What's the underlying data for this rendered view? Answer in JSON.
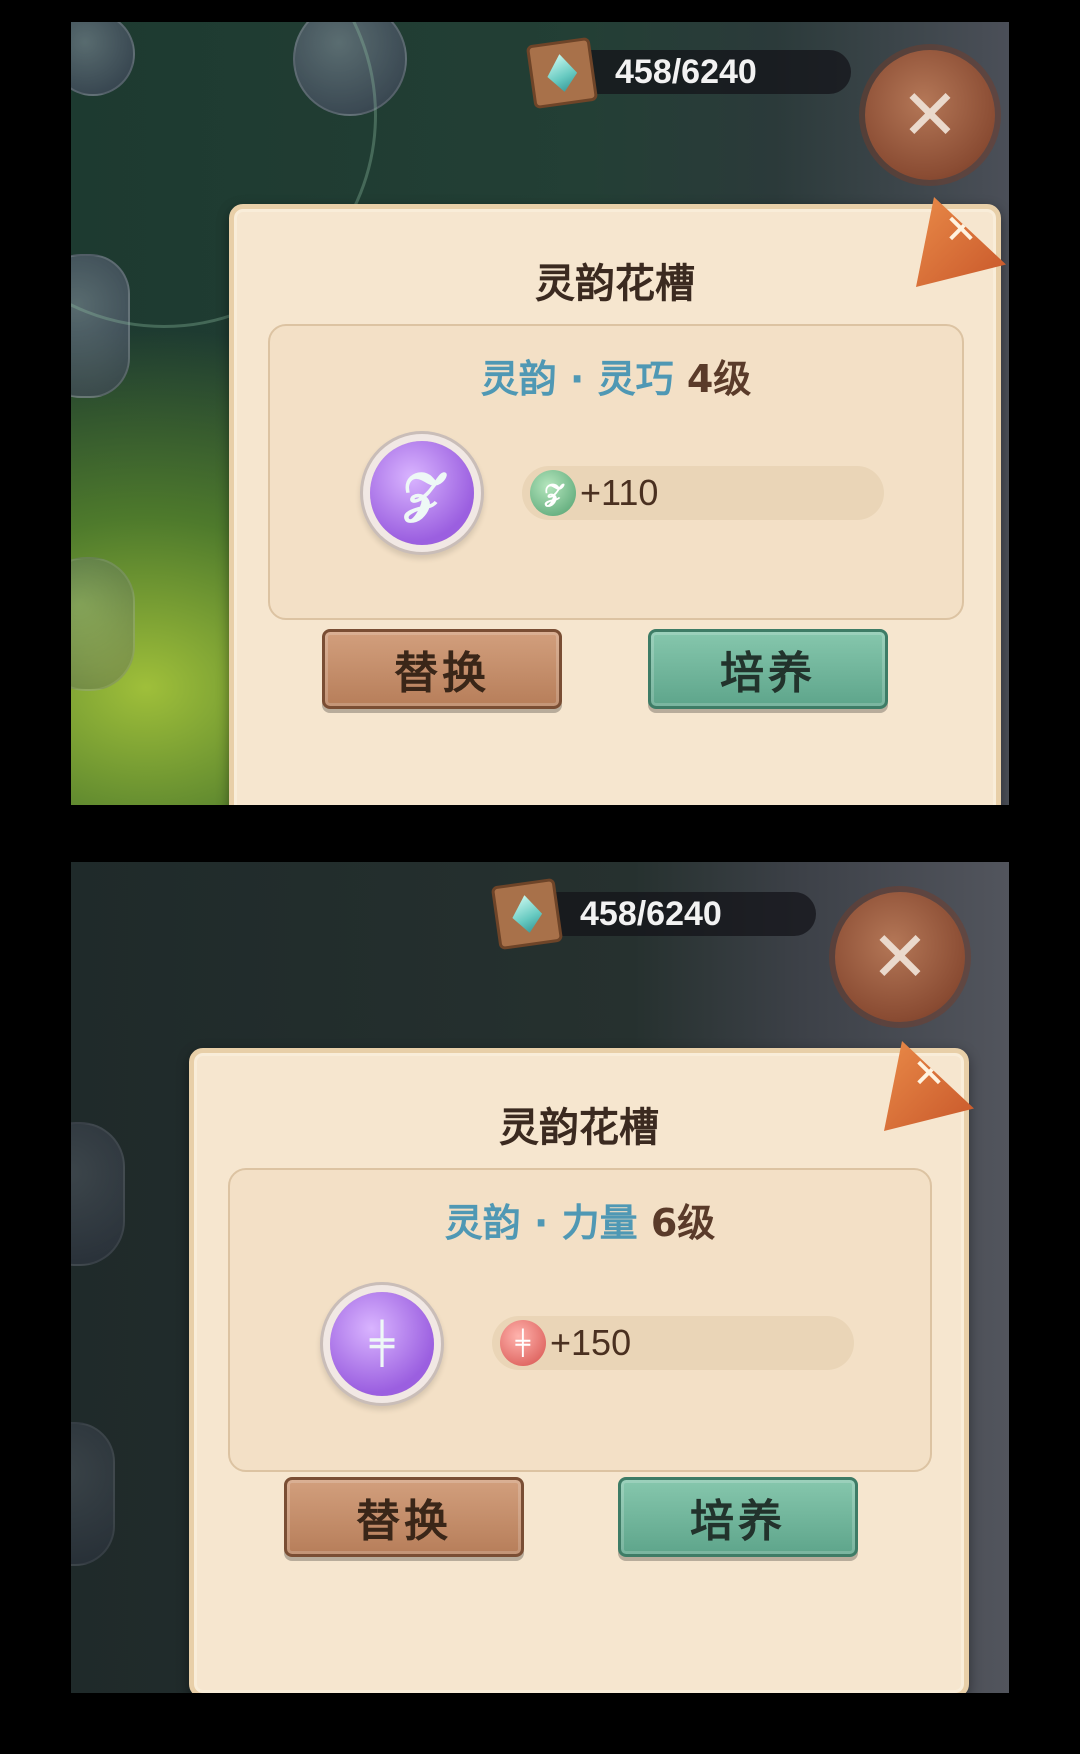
{
  "screens": [
    {
      "currency": {
        "value": "458/6240"
      },
      "dialog": {
        "title": "灵韵花槽",
        "corner_mark": "✕",
        "skill_name": "灵韵 · 灵巧",
        "skill_level": "4级",
        "skill_icon": "wing-boot-icon",
        "bonus_icon": "wing-boot-icon",
        "bonus_value": "+110",
        "replace_label": "替换",
        "train_label": "培养"
      }
    },
    {
      "currency": {
        "value": "458/6240"
      },
      "dialog": {
        "title": "灵韵花槽",
        "corner_mark": "✕",
        "skill_name": "灵韵 · 力量",
        "skill_level": "6级",
        "skill_icon": "dumbbell-icon",
        "bonus_icon": "dumbbell-icon",
        "bonus_value": "+150",
        "replace_label": "替换",
        "train_label": "培养"
      }
    }
  ],
  "colors": {
    "skill_name": "#4f98b4",
    "replace_button": "#c08a66",
    "train_button": "#6fb497",
    "card": "#f6e6cf"
  }
}
